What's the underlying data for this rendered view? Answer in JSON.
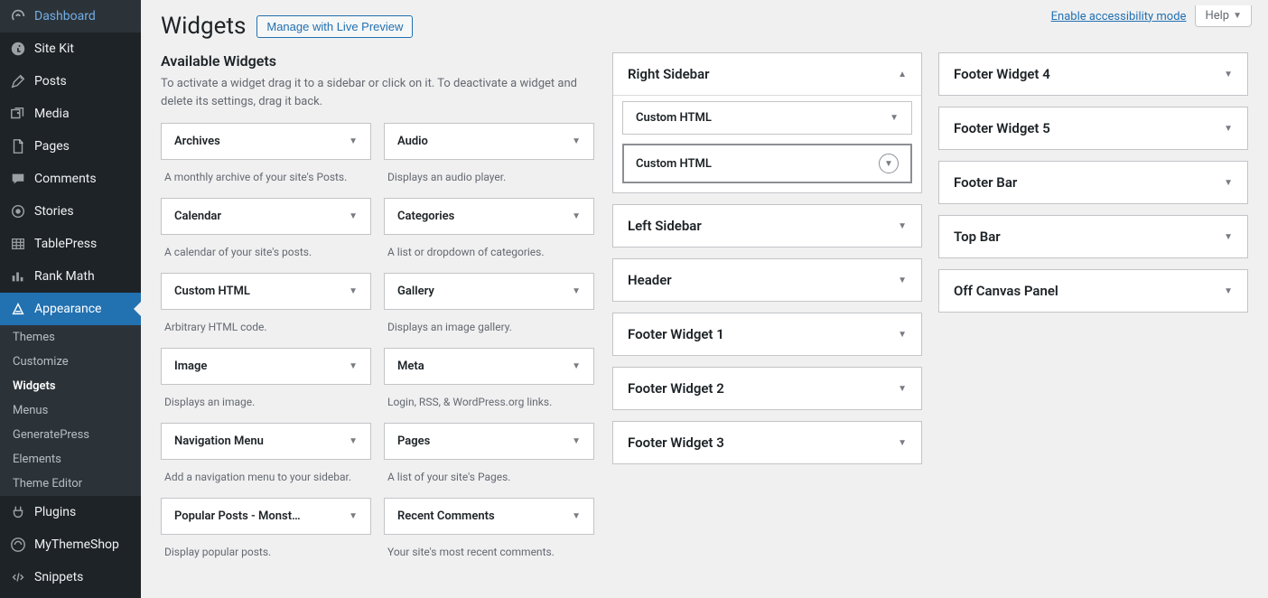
{
  "top": {
    "accessibility_link": "Enable accessibility mode",
    "help_label": "Help"
  },
  "header": {
    "title": "Widgets",
    "live_preview_btn": "Manage with Live Preview"
  },
  "sidebar_menu": [
    {
      "label": "Dashboard",
      "icon": "dashboard"
    },
    {
      "label": "Site Kit",
      "icon": "sitekit"
    },
    {
      "label": "Posts",
      "icon": "posts"
    },
    {
      "label": "Media",
      "icon": "media"
    },
    {
      "label": "Pages",
      "icon": "pages"
    },
    {
      "label": "Comments",
      "icon": "comments"
    },
    {
      "label": "Stories",
      "icon": "stories"
    },
    {
      "label": "TablePress",
      "icon": "tablepress"
    },
    {
      "label": "Rank Math",
      "icon": "rankmath"
    },
    {
      "label": "Appearance",
      "icon": "appearance",
      "current": true,
      "submenu": [
        {
          "label": "Themes"
        },
        {
          "label": "Customize"
        },
        {
          "label": "Widgets",
          "current": true
        },
        {
          "label": "Menus"
        },
        {
          "label": "GeneratePress"
        },
        {
          "label": "Elements"
        },
        {
          "label": "Theme Editor"
        }
      ]
    },
    {
      "label": "Plugins",
      "icon": "plugins"
    },
    {
      "label": "MyThemeShop",
      "icon": "mythemeshop"
    },
    {
      "label": "Snippets",
      "icon": "snippets"
    }
  ],
  "available": {
    "heading": "Available Widgets",
    "description": "To activate a widget drag it to a sidebar or click on it. To deactivate a widget and delete its settings, drag it back.",
    "widgets": [
      {
        "title": "Archives",
        "desc": "A monthly archive of your site's Posts."
      },
      {
        "title": "Audio",
        "desc": "Displays an audio player."
      },
      {
        "title": "Calendar",
        "desc": "A calendar of your site's posts."
      },
      {
        "title": "Categories",
        "desc": "A list or dropdown of categories."
      },
      {
        "title": "Custom HTML",
        "desc": "Arbitrary HTML code."
      },
      {
        "title": "Gallery",
        "desc": "Displays an image gallery."
      },
      {
        "title": "Image",
        "desc": "Displays an image."
      },
      {
        "title": "Meta",
        "desc": "Login, RSS, & WordPress.org links."
      },
      {
        "title": "Navigation Menu",
        "desc": "Add a navigation menu to your sidebar."
      },
      {
        "title": "Pages",
        "desc": "A list of your site's Pages."
      },
      {
        "title": "Popular Posts - Monst…",
        "desc": "Display popular posts."
      },
      {
        "title": "Recent Comments",
        "desc": "Your site's most recent comments."
      }
    ]
  },
  "areas_left": [
    {
      "title": "Right Sidebar",
      "expanded": true,
      "widgets": [
        {
          "title": "Custom HTML",
          "highlight": false
        },
        {
          "title": "Custom HTML",
          "highlight": true
        }
      ]
    },
    {
      "title": "Left Sidebar"
    },
    {
      "title": "Header"
    },
    {
      "title": "Footer Widget 1"
    },
    {
      "title": "Footer Widget 2"
    },
    {
      "title": "Footer Widget 3"
    }
  ],
  "areas_right": [
    {
      "title": "Footer Widget 4"
    },
    {
      "title": "Footer Widget 5"
    },
    {
      "title": "Footer Bar"
    },
    {
      "title": "Top Bar"
    },
    {
      "title": "Off Canvas Panel"
    }
  ]
}
